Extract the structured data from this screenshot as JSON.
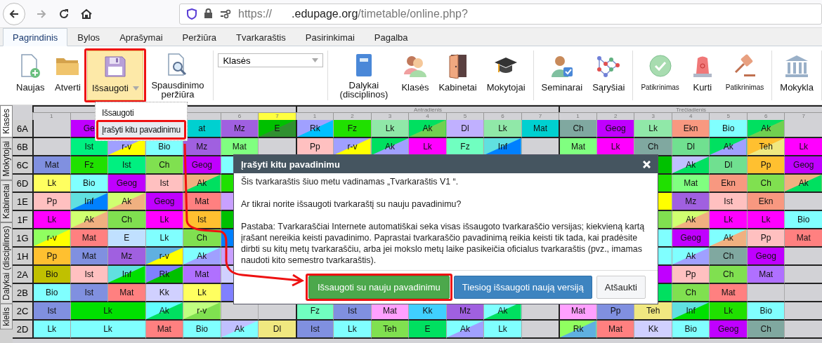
{
  "browser": {
    "url": {
      "scheme": "https://",
      "host": ".edupage.org",
      "path": "/timetable/online.php?"
    }
  },
  "ribbon_tabs": [
    {
      "label": "Pagrindinis",
      "selected": true
    },
    {
      "label": "Bylos",
      "selected": false
    },
    {
      "label": "Aprašymai",
      "selected": false
    },
    {
      "label": "Peržiūra",
      "selected": false
    },
    {
      "label": "Tvarkaraštis",
      "selected": false
    },
    {
      "label": "Pasirinkimai",
      "selected": false
    },
    {
      "label": "Pagalba",
      "selected": false
    }
  ],
  "toolbar": {
    "groups": [
      [
        {
          "kind": "new",
          "label": "Naujas"
        },
        {
          "kind": "open",
          "label": "Atverti"
        },
        {
          "kind": "save",
          "label": "Išsaugoti",
          "highlighted": true,
          "dropdown": true
        },
        {
          "kind": "preview",
          "label": "Spausdinimo peržiūra"
        }
      ],
      [
        {
          "kind": "select",
          "value": "Klasės"
        }
      ],
      [
        {
          "kind": "subjects",
          "label": "Dalykai (disciplinos)"
        },
        {
          "kind": "classes",
          "label": "Klasės"
        },
        {
          "kind": "rooms",
          "label": "Kabinetai"
        },
        {
          "kind": "teachers",
          "label": "Mokytojai"
        }
      ],
      [
        {
          "kind": "seminars",
          "label": "Seminarai"
        },
        {
          "kind": "relations",
          "label": "Sąryšiai"
        }
      ],
      [
        {
          "kind": "check",
          "label": "Patikrinimas",
          "small": true
        },
        {
          "kind": "generate",
          "label": "Kurti"
        },
        {
          "kind": "verdict",
          "label": "Patikrinimas",
          "small": true
        }
      ],
      [
        {
          "kind": "school",
          "label": "Mokykla"
        }
      ]
    ]
  },
  "save_menu": {
    "items": [
      {
        "label": "Išsaugoti",
        "selected": false
      },
      {
        "label": "Įrašyti kitu pavadinimu",
        "selected": true
      }
    ]
  },
  "side_tabs": [
    {
      "label": "Klasės",
      "selected": true
    },
    {
      "label": "Mokytojai",
      "selected": false
    },
    {
      "label": "Kabinetai",
      "selected": false
    },
    {
      "label": "Dalykai (disciplinos)",
      "selected": false
    },
    {
      "label": "klelis",
      "selected": false
    }
  ],
  "timetable": {
    "days": [
      {
        "periods": [
          {
            "label": "1",
            "highlighted": false
          },
          {
            "highlighted": false
          }
        ],
        "periods_after_menu": [
          {
            "highlighted": false
          },
          {
            "label": "6",
            "highlighted": false
          },
          {
            "label": "7",
            "highlighted": true
          }
        ]
      },
      {
        "name": "Antradienis",
        "periods": [
          {
            "label": "1",
            "highlighted": false
          },
          {
            "label": "2",
            "highlighted": false
          },
          {
            "label": "3",
            "highlighted": false
          },
          {
            "label": "4",
            "highlighted": false
          },
          {
            "label": "5",
            "highlighted": false
          },
          {
            "label": "6",
            "highlighted": false
          },
          {
            "label": "7",
            "highlighted": false
          }
        ]
      },
      {
        "name": "Trečiadienis",
        "periods": [
          {
            "label": "1",
            "highlighted": false
          },
          {
            "label": "2",
            "highlighted": false
          },
          {
            "label": "3",
            "highlighted": false
          },
          {
            "label": "4",
            "highlighted": false
          },
          {
            "label": "5",
            "highlighted": false
          },
          {
            "label": "6",
            "highlighted": false
          },
          {
            "label": "7",
            "highlighted": false
          }
        ]
      }
    ],
    "rows": [
      {
        "label": "6A",
        "cells": [
          {},
          {
            "text": "Ge",
            "color": "#c000ff"
          },
          null,
          null,
          {
            "text": "at",
            "color": "#00d0d0"
          },
          {
            "text": "Mz",
            "color": "#a060e0"
          },
          {
            "text": "E",
            "color": "#00c000",
            "corner": {
              "color": "#309030"
            }
          },
          {
            "text": "Rk",
            "color": "#a0a0ff",
            "corner": {
              "color": "#00c0ff"
            }
          },
          {
            "text": "Fz",
            "color": "#20e000"
          },
          {
            "text": "Lk",
            "color": "#90e8a8"
          },
          {
            "text": "Ak",
            "color": "#00e060",
            "corner": {
              "color": "#70d050"
            }
          },
          {
            "text": "Dl",
            "color": "#c0b0ff"
          },
          {
            "text": "Lk",
            "color": "#90e8a8"
          },
          {
            "text": "Mat",
            "color": "#00d0d0"
          },
          {
            "text": "Ch",
            "color": "#80a8a0"
          },
          {
            "text": "Geog",
            "color": "#c000ff"
          },
          {
            "text": "Lk",
            "color": "#90e8a8"
          },
          {
            "text": "Ekn",
            "color": "#f89880"
          },
          {
            "text": "Bio",
            "color": "#80ffff"
          },
          {
            "text": "Ak",
            "color": "#00e060",
            "corner": {
              "color": "#70d050"
            }
          },
          {}
        ]
      },
      {
        "label": "6B",
        "cells": [
          {},
          {
            "text": "Ist",
            "color": "#00f080"
          },
          {
            "text": "r-v",
            "color": "#a0a0ff",
            "corner": {
              "color": "#ffff00"
            }
          },
          {
            "text": "Bio",
            "color": "#80ffff"
          },
          {
            "text": "Mz",
            "color": "#a060e0"
          },
          {
            "text": "Mat",
            "color": "#80ff80"
          },
          {},
          {
            "text": "Pp",
            "color": "#ffc0c0"
          },
          {
            "text": "r-v",
            "color": "#a0a0ff",
            "corner": {
              "color": "#ffff00"
            }
          },
          {
            "text": "Ak",
            "color": "#00e060",
            "corner": {
              "color": "#a0a0ff"
            }
          },
          {
            "text": "Lk",
            "color": "#ff00ff"
          },
          {
            "text": "Fz",
            "color": "#70ffc0"
          },
          {
            "text": "Inf",
            "color": "#60e0e0",
            "corner": {
              "color": "#0080ff"
            }
          },
          {},
          {
            "text": "Mat",
            "color": "#80ff80"
          },
          {
            "text": "Lk",
            "color": "#ff00ff"
          },
          {
            "text": "Ch",
            "color": "#80a8a0"
          },
          {
            "text": "Dl",
            "color": "#70e090"
          },
          {
            "text": "Ak",
            "color": "#00e060",
            "corner": {
              "color": "#a0a0ff"
            }
          },
          {
            "text": "Teh",
            "color": "#ffc030",
            "corner": {
              "color": "#f0e880"
            }
          },
          {
            "text": "Lk",
            "color": "#ff00ff"
          }
        ]
      },
      {
        "label": "6C",
        "cells": [
          {
            "text": "Mat",
            "color": "#8090e0"
          },
          {
            "text": "Fz",
            "color": "#20e000"
          },
          {
            "text": "Ist",
            "color": "#00f080"
          },
          {
            "text": "Ch",
            "color": "#80e050"
          },
          {
            "text": "Geog",
            "color": "#c000ff"
          },
          {
            "color": "#80ffff"
          },
          null,
          null,
          null,
          null,
          null,
          null,
          null,
          null,
          null,
          null,
          {
            "color": "#00c000"
          },
          {
            "text": "Ak",
            "color": "#c0c0ff",
            "corner": {
              "color": "#00e060"
            }
          },
          {
            "text": "Dl",
            "color": "#70e090"
          },
          {
            "text": "Pp",
            "color": "#ffc030"
          },
          {
            "text": "Geog",
            "color": "#c000ff"
          }
        ]
      },
      {
        "label": "6D",
        "cells": [
          {
            "text": "Lk",
            "color": "#ffff60"
          },
          {
            "text": "Bio",
            "color": "#80ffff"
          },
          {
            "text": "Geog",
            "color": "#c000ff"
          },
          {
            "text": "Ist",
            "color": "#ffc0c0"
          },
          {
            "text": "Ak",
            "color": "#f0b080",
            "corner": {
              "color": "#00e060"
            }
          },
          {
            "color": "#20e000"
          },
          null,
          null,
          null,
          null,
          null,
          null,
          null,
          null,
          null,
          null,
          {
            "color": "#20e000"
          },
          {
            "text": "Mat",
            "color": "#80ff80"
          },
          {
            "text": "Ekn",
            "color": "#f89880"
          },
          {
            "text": "Ch",
            "color": "#80e050"
          },
          {
            "text": "Ak",
            "color": "#f0b080",
            "corner": {
              "color": "#00e060"
            }
          }
        ]
      },
      {
        "label": "1E",
        "cells": [
          {
            "text": "Pp",
            "color": "#ffc0c0"
          },
          {
            "text": "Inf",
            "color": "#60e0e0",
            "corner": {
              "color": "#0080ff"
            }
          },
          {
            "text": "Ak",
            "color": "#d0ff70",
            "corner": {
              "color": "#f0b080"
            }
          },
          {
            "text": "Geog",
            "color": "#c000ff"
          },
          {
            "text": "Mat",
            "color": "#ff8080"
          },
          {
            "color": "#c8a0ff"
          },
          null,
          null,
          null,
          null,
          null,
          null,
          null,
          null,
          null,
          null,
          {
            "color": "#ffff00"
          },
          {
            "text": "Mz",
            "color": "#a060e0"
          },
          {
            "text": "Ist",
            "color": "#ffc0c0"
          },
          {
            "text": "Ekn",
            "color": "#f89880"
          },
          {}
        ]
      },
      {
        "label": "1F",
        "cells": [
          {
            "text": "Lk",
            "color": "#ff00ff"
          },
          {
            "text": "Ak",
            "color": "#d0ff70",
            "corner": {
              "color": "#f0b080"
            }
          },
          {
            "text": "Ch",
            "color": "#80e050"
          },
          {
            "text": "Lk",
            "color": "#ff00ff"
          },
          {
            "text": "Ist",
            "color": "#ffc030"
          },
          {
            "color": "#00c000"
          },
          null,
          null,
          null,
          null,
          null,
          null,
          null,
          null,
          null,
          null,
          {
            "color": "#80e050"
          },
          {
            "text": "Ak",
            "color": "#d0ff70",
            "corner": {
              "color": "#f0b080"
            }
          },
          {
            "text": "Lk",
            "color": "#ff00ff"
          },
          {
            "text": "Lk",
            "color": "#ff00ff"
          },
          {
            "text": "Bio",
            "color": "#80ffff"
          }
        ]
      },
      {
        "label": "1G",
        "cells": [
          {
            "text": "r-v",
            "color": "#90ff60",
            "corner": {
              "color": "#ffff00"
            }
          },
          {
            "text": "Mat",
            "color": "#ff8080"
          },
          {
            "text": "E",
            "color": "#c0e0ff"
          },
          {
            "text": "Lk",
            "color": "#80ffff"
          },
          {
            "text": "Ch",
            "color": "#80e050"
          },
          {
            "color": "#0080ff"
          },
          null,
          null,
          null,
          null,
          null,
          null,
          null,
          null,
          null,
          null,
          {
            "color": "#80ffff"
          },
          {
            "text": "Geog",
            "color": "#c000ff"
          },
          {
            "text": "Ak",
            "color": "#80ffff",
            "corner": {
              "color": "#f0b080"
            }
          },
          {
            "text": "Pp",
            "color": "#ffc0c0"
          },
          {
            "text": "Mat",
            "color": "#ff8080"
          }
        ]
      },
      {
        "label": "1H",
        "cells": [
          {
            "text": "Pp",
            "color": "#ffc030"
          },
          {
            "text": "Mat",
            "color": "#8090e0"
          },
          {
            "text": "Mz",
            "color": "#a060e0"
          },
          {
            "text": "r-v",
            "color": "#60b0e0",
            "corner": {
              "color": "#ffff00"
            }
          },
          {
            "text": "Ak",
            "color": "#80ffff",
            "corner": {
              "color": "#a0a0ff"
            }
          },
          {
            "color": "#c8a0ff"
          },
          null,
          null,
          null,
          null,
          null,
          null,
          null,
          null,
          null,
          null,
          {
            "color": "#80ffff"
          },
          {
            "text": "Ak",
            "color": "#80ffff",
            "corner": {
              "color": "#a0a0ff"
            }
          },
          {
            "text": "Ch",
            "color": "#80a8a0"
          },
          {
            "text": "Geog",
            "color": "#c000ff"
          },
          {}
        ]
      },
      {
        "label": "2A",
        "cells": [
          {
            "text": "Bio",
            "color": "#c0c000"
          },
          {
            "text": "Ist",
            "color": "#ffc0c0"
          },
          {
            "text": "Inf",
            "color": "#60e0e0",
            "corner": {
              "color": "#00e000"
            }
          },
          {
            "text": "Rk",
            "color": "#8080ff",
            "corner": {
              "color": "#00c000"
            }
          },
          {
            "text": "Mat",
            "color": "#b070ff"
          },
          {
            "color": "#d0d0ff"
          },
          null,
          null,
          null,
          null,
          null,
          null,
          null,
          null,
          null,
          null,
          {
            "color": "#c000ff"
          },
          {
            "text": "Pp",
            "color": "#ffc0c0"
          },
          {
            "text": "Ch",
            "color": "#80e050"
          },
          {
            "text": "Mat",
            "color": "#b070ff"
          },
          {}
        ]
      },
      {
        "label": "2B",
        "cells": [
          {
            "text": "Bio",
            "color": "#80ffff"
          },
          {
            "text": "Ist",
            "color": "#8090e0"
          },
          {
            "text": "Mat",
            "color": "#ff8080"
          },
          {
            "text": "Kk",
            "color": "#d0d0ff"
          },
          {
            "text": "Lk",
            "color": "#ffff60"
          },
          {
            "color": "#8080ff"
          },
          null,
          null,
          null,
          null,
          null,
          null,
          null,
          null,
          null,
          null,
          {
            "color": "#00e060"
          },
          {
            "text": "Ch",
            "color": "#80e050"
          },
          {
            "text": "Mat",
            "color": "#ff8080"
          },
          {},
          {}
        ]
      },
      {
        "label": "2C",
        "cells": [
          {
            "text": "Ist",
            "color": "#8090e0"
          },
          {
            "text": "Lk",
            "color": "#00e000"
          },
          {
            "continued": true
          },
          {
            "text": "Ak",
            "color": "#60ffff",
            "corner": {
              "color": "#00e060"
            }
          },
          {
            "text": "r-v",
            "color": "#c0ff80",
            "corner": {
              "color": "#80e050"
            }
          },
          {},
          {},
          {
            "text": "Fz",
            "color": "#70ffc0"
          },
          {
            "text": "Ist",
            "color": "#8090e0"
          },
          {
            "text": "Mat",
            "color": "#ffa0ff"
          },
          {
            "text": "Kk",
            "color": "#40d0ff"
          },
          {
            "text": "Mz",
            "color": "#a060e0"
          },
          {
            "text": "Ak",
            "color": "#80ffff",
            "corner": {
              "color": "#00e060"
            }
          },
          {},
          {
            "text": "Mat",
            "color": "#ffa0ff"
          },
          {
            "text": "Pp",
            "color": "#8090e0"
          },
          {
            "text": "Teh",
            "color": "#f0e880"
          },
          {
            "text": "Inf",
            "color": "#60e0e0",
            "corner": {
              "color": "#00e000"
            }
          },
          {
            "text": "Lk",
            "color": "#20e000"
          },
          {
            "text": "Bio",
            "color": "#80ffff"
          },
          {}
        ]
      },
      {
        "label": "2D",
        "cells": [
          {
            "text": "Lk",
            "color": "#80ffff"
          },
          {
            "text": "Lk",
            "color": "#80ffff"
          },
          {
            "continued": true
          },
          {
            "text": "Mat",
            "color": "#ff8080"
          },
          {
            "text": "Bio",
            "color": "#80ffff"
          },
          {
            "text": "Ak",
            "color": "#c0c0ff",
            "corner": {
              "color": "#80ffff"
            }
          },
          {
            "text": "Dl",
            "color": "#f0e880"
          },
          {
            "text": "Ist",
            "color": "#8090e0"
          },
          {
            "text": "Lk",
            "color": "#80ffff"
          },
          {
            "text": "Teh",
            "color": "#80e050"
          },
          {
            "text": "E",
            "color": "#00e060"
          },
          {
            "text": "Ak",
            "color": "#80ffff",
            "corner": {
              "color": "#a0a0ff"
            }
          },
          {
            "text": "Lk",
            "color": "#80ffff"
          },
          {},
          {
            "text": "Rk",
            "color": "#90ff60",
            "corner": {
              "color": "#60b0e0"
            }
          },
          {
            "text": "Mat",
            "color": "#ff8080"
          },
          {
            "text": "Kk",
            "color": "#d0d0ff"
          },
          {
            "text": "Bio",
            "color": "#80ffff"
          },
          {
            "text": "Geog",
            "color": "#c000ff"
          },
          {
            "text": "Ch",
            "color": "#80a8a0"
          },
          {}
        ]
      }
    ]
  },
  "dialog": {
    "title": "Įrašyti kitu pavadinimu",
    "paragraphs": [
      "Šis tvarkaraštis šiuo metu vadinamas „Tvarkaraštis V1 “.",
      "Ar tikrai norite išsaugoti tvarkaraštį su nauju pavadinimu?",
      "Pastaba: Tvarkaraščiai Internete automatiškai seka visas išsaugoto tvarkaraščio versijas;  kiekvieną kartą įrašant nereikia keisti pavadinimo. Paprastai tvarkaraščio pavadinimą reikia keisti tik tada, kai pradėsite dirbti su kitų metų tvarkaraščiu, arba jei mokslo metų laike  pasikeičia oficialus tvarkaraštis (pvz., imamas naudoti kito semestro tvarkaraštis)."
    ],
    "buttons": [
      {
        "label": "Išsaugoti su nauju pavadinimu",
        "kind": "success"
      },
      {
        "label": "Tiesiog išsaugoti naują versiją",
        "kind": "primary"
      },
      {
        "label": "Atšaukti",
        "kind": "default"
      }
    ]
  }
}
